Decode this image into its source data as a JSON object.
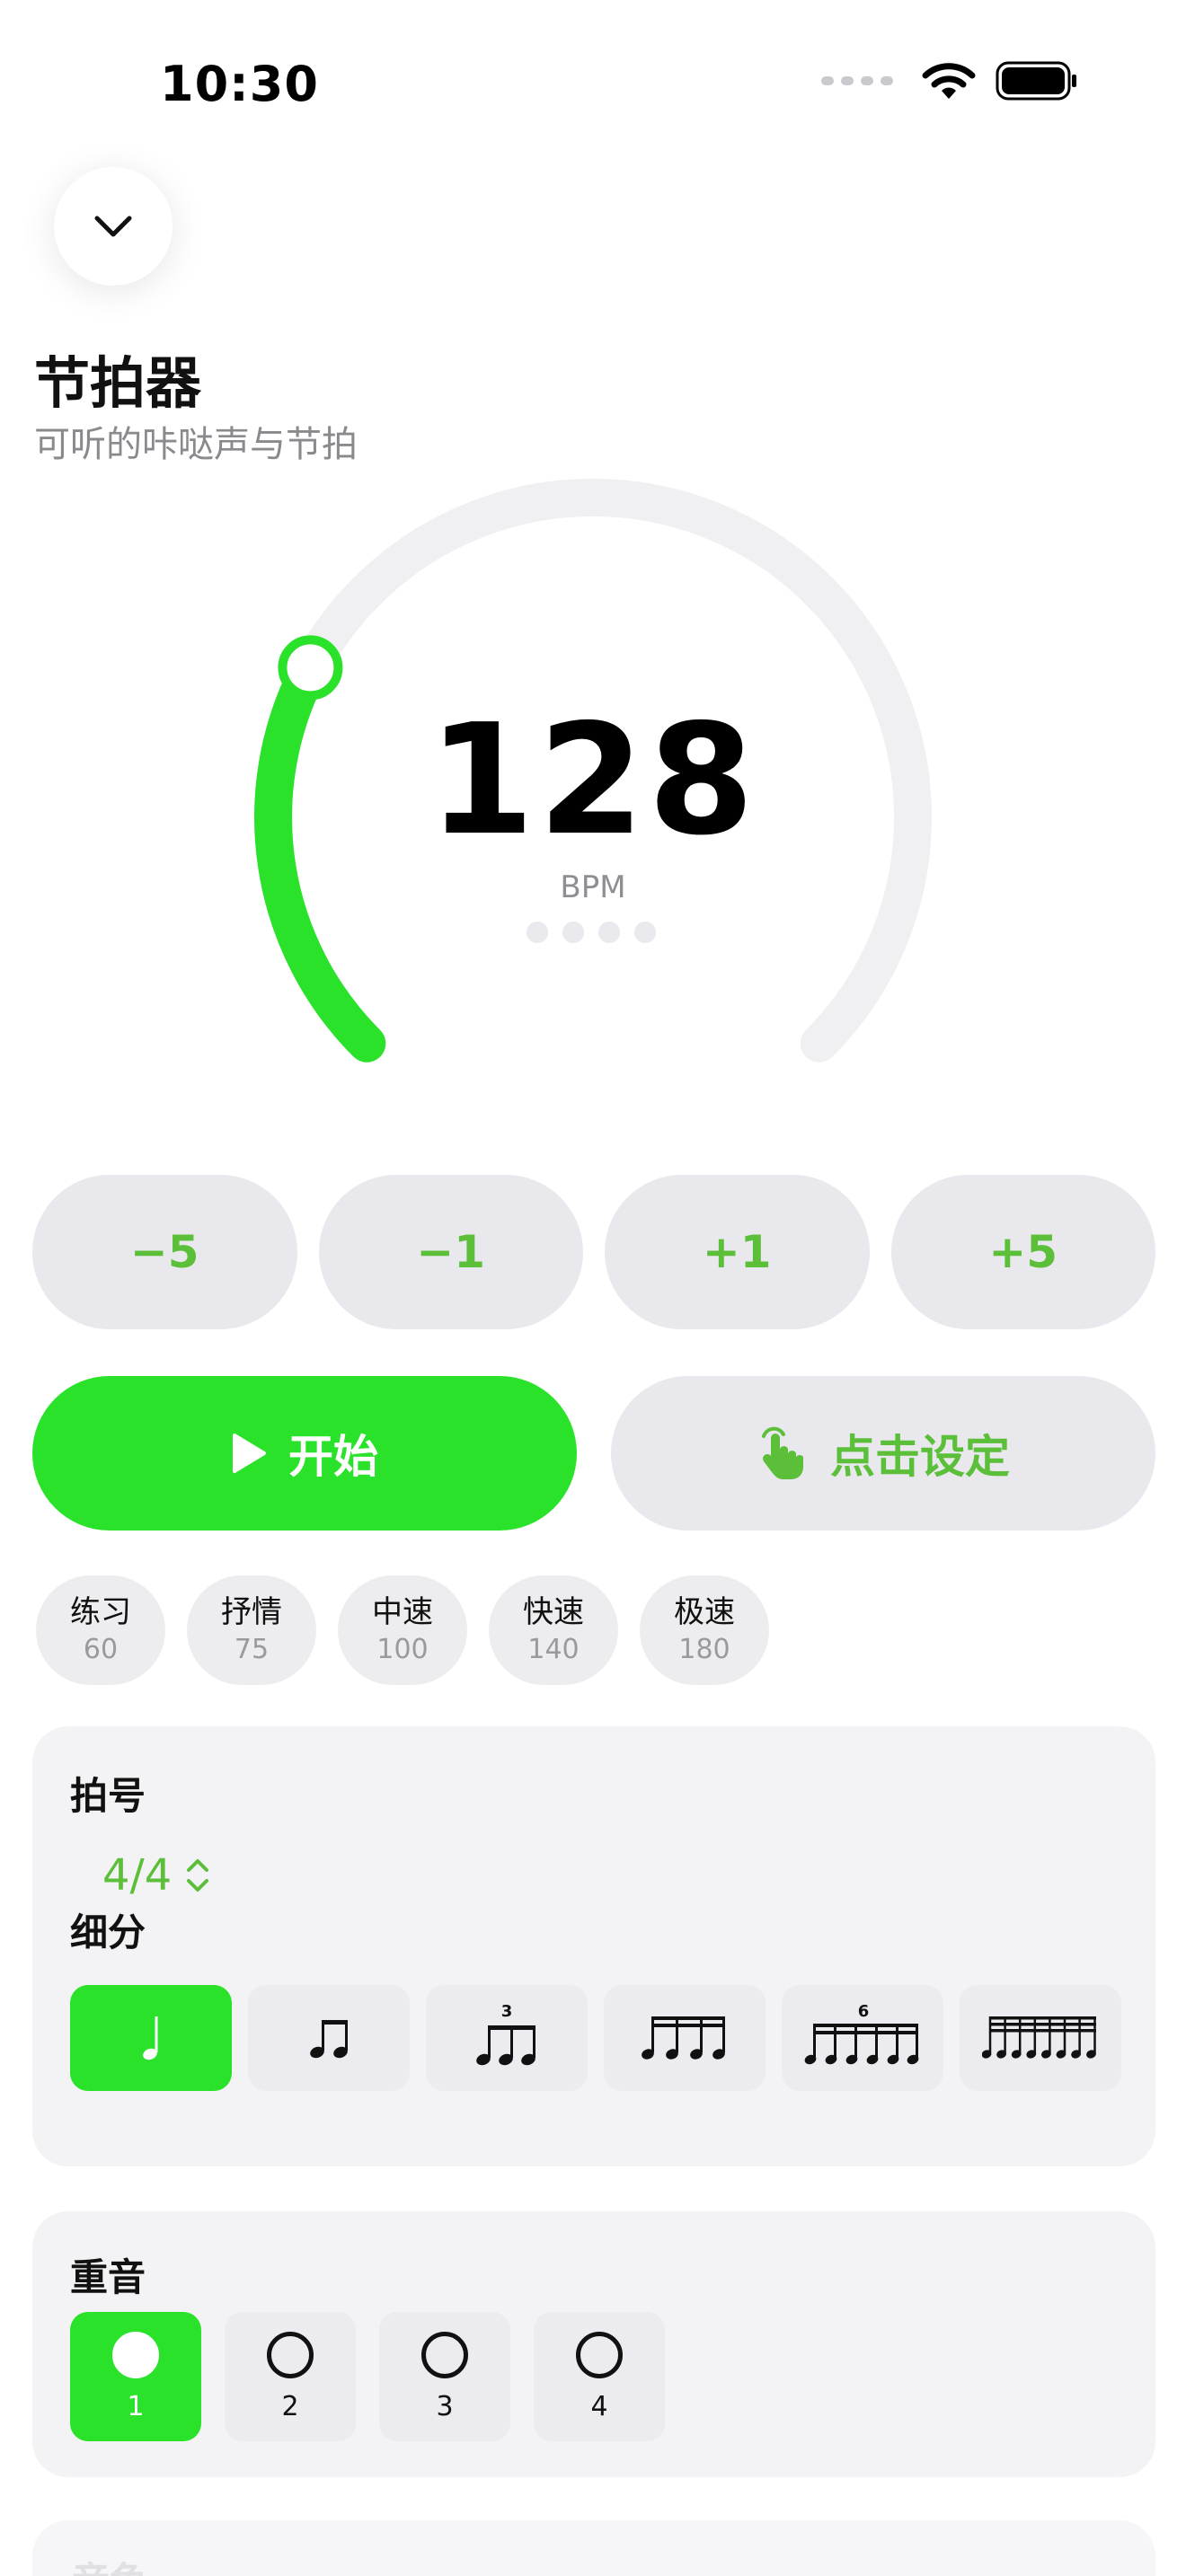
{
  "status_bar": {
    "time": "10:30"
  },
  "header": {
    "title": "节拍器",
    "subtitle": "可听的咔哒声与节拍"
  },
  "tempo": {
    "bpm": "128",
    "unit": "BPM",
    "dial_fraction": 0.27,
    "beat_count": 4
  },
  "steppers": [
    "−5",
    "−1",
    "+1",
    "+5"
  ],
  "actions": {
    "start_label": "开始",
    "tap_label": "点击设定"
  },
  "presets": [
    {
      "name": "练习",
      "bpm": "60"
    },
    {
      "name": "抒情",
      "bpm": "75"
    },
    {
      "name": "中速",
      "bpm": "100"
    },
    {
      "name": "快速",
      "bpm": "140"
    },
    {
      "name": "极速",
      "bpm": "180"
    }
  ],
  "time_signature": {
    "label": "拍号",
    "value": "4/4"
  },
  "subdivision": {
    "label": "细分",
    "options": [
      "quarter-note-icon",
      "eighth-notes-icon",
      "triplet-icon",
      "sixteenth-notes-icon",
      "sextuplet-icon",
      "thirty-second-notes-icon"
    ],
    "selected": 0,
    "triplet_number": "3",
    "sextuplet_number": "6"
  },
  "accent": {
    "label": "重音",
    "beats": [
      "1",
      "2",
      "3",
      "4"
    ],
    "selected": 0
  },
  "next_section": {
    "label": "音色"
  },
  "colors": {
    "accent": "#2AE22A",
    "accent_text": "#5CBF3A",
    "track": "#F0F0F3",
    "chip": "#E8E8ED"
  }
}
